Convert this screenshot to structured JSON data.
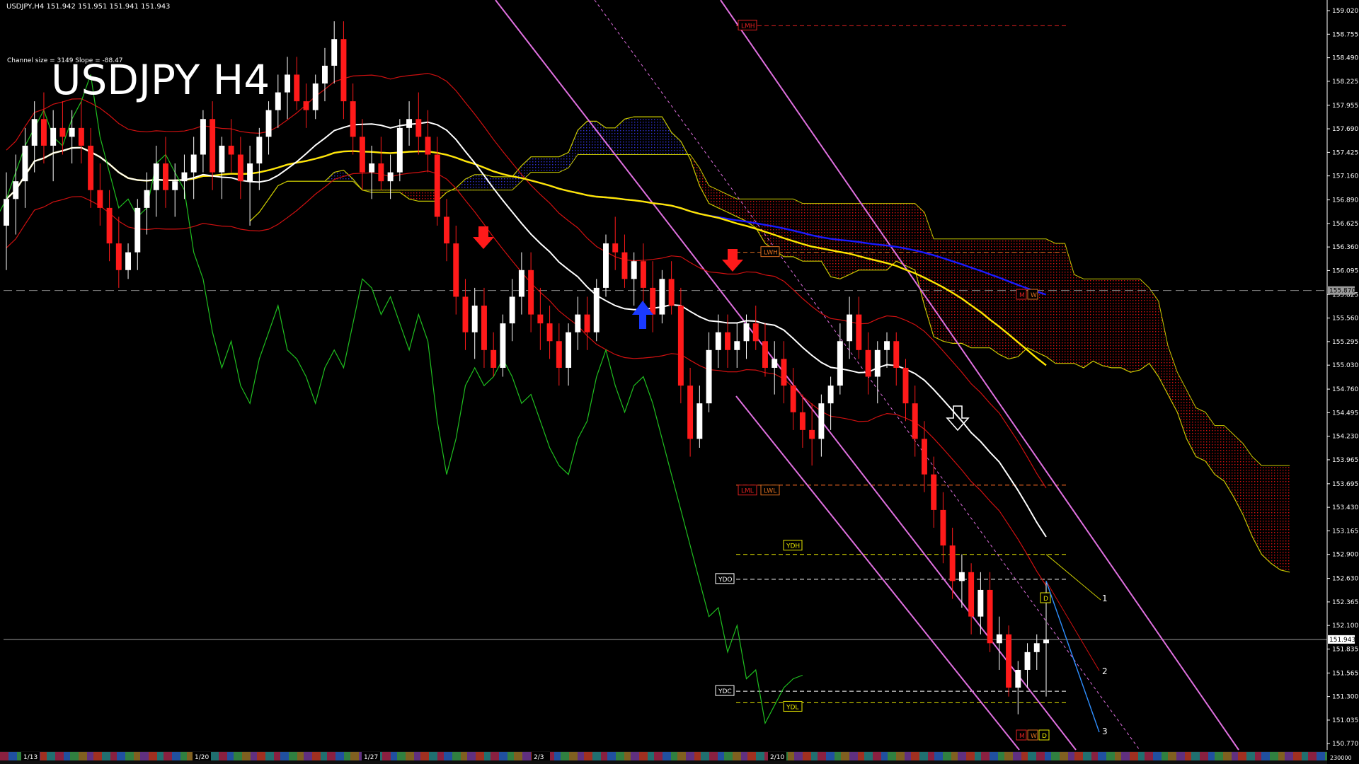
{
  "window": {
    "header": "USDJPY,H4  151.942 151.951 151.941 151.943",
    "channel_info": "Channel size = 3149 Slope = -88.47",
    "overlay_title": "USDJPY H4"
  },
  "colors": {
    "background": "#000000",
    "bull_candle": "#ffffff",
    "bear_candle": "#ff1a1a",
    "ma_white": "#ffffff",
    "ma_yellow": "#ffe600",
    "ma_blue": "#1a1aff",
    "chikou_green": "#1fbf1f",
    "envelope_red": "#d01010",
    "envelope_yellow": "#c8c800",
    "channel_violet": "#e070e0",
    "cloud_blue": "#2020c0",
    "cloud_red": "#c01010",
    "forecast_blue": "#2f8fff"
  },
  "chart_data": {
    "type": "candlestick",
    "symbol": "USDJPY",
    "timeframe": "H4",
    "last_price": 151.943,
    "current_price_label": "151.943",
    "reference_price_label": "155.870",
    "ylim": [
      150.7,
      159.1
    ],
    "y_tick_labels": [
      "159.020",
      "158.755",
      "158.490",
      "158.225",
      "157.955",
      "157.690",
      "157.425",
      "157.160",
      "156.890",
      "156.625",
      "156.360",
      "156.095",
      "155.825",
      "155.560",
      "155.295",
      "155.030",
      "154.760",
      "154.495",
      "154.230",
      "153.965",
      "153.695",
      "153.430",
      "153.165",
      "152.900",
      "152.630",
      "152.365",
      "152.100",
      "151.835",
      "151.565",
      "151.300",
      "151.035",
      "150.770"
    ],
    "x_tick_labels": [
      "1/13",
      "1/20",
      "1/27",
      "2/3",
      "2/10"
    ],
    "volume_scale_label": "230000",
    "candles": [
      {
        "o": 156.6,
        "h": 157.2,
        "l": 156.1,
        "c": 156.9
      },
      {
        "o": 156.9,
        "h": 157.4,
        "l": 156.5,
        "c": 157.1
      },
      {
        "o": 157.1,
        "h": 157.7,
        "l": 156.8,
        "c": 157.5
      },
      {
        "o": 157.5,
        "h": 158.0,
        "l": 157.2,
        "c": 157.8
      },
      {
        "o": 157.8,
        "h": 158.1,
        "l": 157.3,
        "c": 157.5
      },
      {
        "o": 157.5,
        "h": 157.9,
        "l": 157.1,
        "c": 157.7
      },
      {
        "o": 157.7,
        "h": 158.0,
        "l": 157.4,
        "c": 157.6
      },
      {
        "o": 157.6,
        "h": 157.9,
        "l": 157.3,
        "c": 157.7
      },
      {
        "o": 157.7,
        "h": 158.0,
        "l": 157.3,
        "c": 157.5
      },
      {
        "o": 157.5,
        "h": 157.7,
        "l": 156.8,
        "c": 157.0
      },
      {
        "o": 157.0,
        "h": 157.3,
        "l": 156.6,
        "c": 156.8
      },
      {
        "o": 156.8,
        "h": 157.0,
        "l": 156.2,
        "c": 156.4
      },
      {
        "o": 156.4,
        "h": 156.7,
        "l": 155.9,
        "c": 156.1
      },
      {
        "o": 156.1,
        "h": 156.4,
        "l": 156.0,
        "c": 156.3
      },
      {
        "o": 156.3,
        "h": 156.9,
        "l": 156.1,
        "c": 156.8
      },
      {
        "o": 156.8,
        "h": 157.2,
        "l": 156.5,
        "c": 157.0
      },
      {
        "o": 157.0,
        "h": 157.5,
        "l": 156.7,
        "c": 157.3
      },
      {
        "o": 157.3,
        "h": 157.6,
        "l": 156.8,
        "c": 157.0
      },
      {
        "o": 157.0,
        "h": 157.3,
        "l": 156.7,
        "c": 157.1
      },
      {
        "o": 157.1,
        "h": 157.4,
        "l": 156.9,
        "c": 157.2
      },
      {
        "o": 157.2,
        "h": 157.6,
        "l": 156.9,
        "c": 157.4
      },
      {
        "o": 157.4,
        "h": 157.9,
        "l": 157.2,
        "c": 157.8
      },
      {
        "o": 157.8,
        "h": 158.0,
        "l": 157.0,
        "c": 157.2
      },
      {
        "o": 157.2,
        "h": 157.6,
        "l": 156.9,
        "c": 157.5
      },
      {
        "o": 157.5,
        "h": 157.8,
        "l": 157.2,
        "c": 157.4
      },
      {
        "o": 157.4,
        "h": 157.6,
        "l": 156.9,
        "c": 157.1
      },
      {
        "o": 157.1,
        "h": 157.5,
        "l": 156.6,
        "c": 157.3
      },
      {
        "o": 157.3,
        "h": 157.7,
        "l": 157.0,
        "c": 157.6
      },
      {
        "o": 157.6,
        "h": 158.0,
        "l": 157.4,
        "c": 157.9
      },
      {
        "o": 157.9,
        "h": 158.3,
        "l": 157.7,
        "c": 158.1
      },
      {
        "o": 158.1,
        "h": 158.5,
        "l": 157.8,
        "c": 158.3
      },
      {
        "o": 158.3,
        "h": 158.5,
        "l": 157.9,
        "c": 158.0
      },
      {
        "o": 158.0,
        "h": 158.2,
        "l": 157.7,
        "c": 157.9
      },
      {
        "o": 157.9,
        "h": 158.3,
        "l": 157.8,
        "c": 158.2
      },
      {
        "o": 158.2,
        "h": 158.6,
        "l": 158.0,
        "c": 158.4
      },
      {
        "o": 158.4,
        "h": 158.9,
        "l": 158.2,
        "c": 158.7
      },
      {
        "o": 158.7,
        "h": 158.9,
        "l": 157.8,
        "c": 158.0
      },
      {
        "o": 158.0,
        "h": 158.2,
        "l": 157.4,
        "c": 157.6
      },
      {
        "o": 157.6,
        "h": 157.8,
        "l": 157.0,
        "c": 157.2
      },
      {
        "o": 157.2,
        "h": 157.5,
        "l": 156.9,
        "c": 157.3
      },
      {
        "o": 157.3,
        "h": 157.6,
        "l": 157.0,
        "c": 157.1
      },
      {
        "o": 157.1,
        "h": 157.4,
        "l": 156.9,
        "c": 157.2
      },
      {
        "o": 157.2,
        "h": 157.8,
        "l": 157.1,
        "c": 157.7
      },
      {
        "o": 157.7,
        "h": 158.0,
        "l": 157.5,
        "c": 157.8
      },
      {
        "o": 157.8,
        "h": 158.1,
        "l": 157.4,
        "c": 157.6
      },
      {
        "o": 157.6,
        "h": 157.9,
        "l": 157.2,
        "c": 157.4
      },
      {
        "o": 157.4,
        "h": 157.6,
        "l": 156.6,
        "c": 156.7
      },
      {
        "o": 156.7,
        "h": 156.9,
        "l": 156.2,
        "c": 156.4
      },
      {
        "o": 156.4,
        "h": 156.6,
        "l": 155.6,
        "c": 155.8
      },
      {
        "o": 155.8,
        "h": 156.0,
        "l": 155.2,
        "c": 155.4
      },
      {
        "o": 155.4,
        "h": 155.9,
        "l": 155.1,
        "c": 155.7
      },
      {
        "o": 155.7,
        "h": 155.9,
        "l": 155.0,
        "c": 155.2
      },
      {
        "o": 155.2,
        "h": 155.4,
        "l": 154.9,
        "c": 155.0
      },
      {
        "o": 155.0,
        "h": 155.6,
        "l": 154.9,
        "c": 155.5
      },
      {
        "o": 155.5,
        "h": 156.0,
        "l": 155.3,
        "c": 155.8
      },
      {
        "o": 155.8,
        "h": 156.3,
        "l": 155.6,
        "c": 156.1
      },
      {
        "o": 156.1,
        "h": 156.3,
        "l": 155.4,
        "c": 155.6
      },
      {
        "o": 155.6,
        "h": 155.9,
        "l": 155.2,
        "c": 155.5
      },
      {
        "o": 155.5,
        "h": 155.7,
        "l": 155.1,
        "c": 155.3
      },
      {
        "o": 155.3,
        "h": 155.5,
        "l": 154.8,
        "c": 155.0
      },
      {
        "o": 155.0,
        "h": 155.5,
        "l": 154.8,
        "c": 155.4
      },
      {
        "o": 155.4,
        "h": 155.8,
        "l": 155.2,
        "c": 155.6
      },
      {
        "o": 155.6,
        "h": 155.8,
        "l": 155.2,
        "c": 155.4
      },
      {
        "o": 155.4,
        "h": 156.0,
        "l": 155.3,
        "c": 155.9
      },
      {
        "o": 155.9,
        "h": 156.5,
        "l": 155.8,
        "c": 156.4
      },
      {
        "o": 156.4,
        "h": 156.7,
        "l": 156.1,
        "c": 156.3
      },
      {
        "o": 156.3,
        "h": 156.5,
        "l": 155.9,
        "c": 156.0
      },
      {
        "o": 156.0,
        "h": 156.3,
        "l": 155.7,
        "c": 156.2
      },
      {
        "o": 156.2,
        "h": 156.4,
        "l": 155.7,
        "c": 155.9
      },
      {
        "o": 155.9,
        "h": 156.2,
        "l": 155.4,
        "c": 155.6
      },
      {
        "o": 155.6,
        "h": 156.1,
        "l": 155.5,
        "c": 156.0
      },
      {
        "o": 156.0,
        "h": 156.2,
        "l": 155.6,
        "c": 155.7
      },
      {
        "o": 155.7,
        "h": 155.9,
        "l": 154.6,
        "c": 154.8
      },
      {
        "o": 154.8,
        "h": 155.0,
        "l": 154.0,
        "c": 154.2
      },
      {
        "o": 154.2,
        "h": 154.8,
        "l": 154.1,
        "c": 154.6
      },
      {
        "o": 154.6,
        "h": 155.4,
        "l": 154.5,
        "c": 155.2
      },
      {
        "o": 155.2,
        "h": 155.6,
        "l": 155.0,
        "c": 155.4
      },
      {
        "o": 155.4,
        "h": 155.6,
        "l": 155.0,
        "c": 155.2
      },
      {
        "o": 155.2,
        "h": 155.5,
        "l": 155.0,
        "c": 155.3
      },
      {
        "o": 155.3,
        "h": 155.6,
        "l": 155.1,
        "c": 155.5
      },
      {
        "o": 155.5,
        "h": 155.7,
        "l": 155.2,
        "c": 155.3
      },
      {
        "o": 155.3,
        "h": 155.5,
        "l": 154.9,
        "c": 155.0
      },
      {
        "o": 155.0,
        "h": 155.3,
        "l": 154.7,
        "c": 155.1
      },
      {
        "o": 155.1,
        "h": 155.3,
        "l": 154.6,
        "c": 154.8
      },
      {
        "o": 154.8,
        "h": 155.0,
        "l": 154.3,
        "c": 154.5
      },
      {
        "o": 154.5,
        "h": 154.7,
        "l": 154.1,
        "c": 154.3
      },
      {
        "o": 154.3,
        "h": 154.6,
        "l": 153.9,
        "c": 154.2
      },
      {
        "o": 154.2,
        "h": 154.7,
        "l": 154.0,
        "c": 154.6
      },
      {
        "o": 154.6,
        "h": 154.9,
        "l": 154.3,
        "c": 154.8
      },
      {
        "o": 154.8,
        "h": 155.5,
        "l": 154.7,
        "c": 155.3
      },
      {
        "o": 155.3,
        "h": 155.8,
        "l": 155.1,
        "c": 155.6
      },
      {
        "o": 155.6,
        "h": 155.8,
        "l": 155.1,
        "c": 155.2
      },
      {
        "o": 155.2,
        "h": 155.4,
        "l": 154.7,
        "c": 154.9
      },
      {
        "o": 154.9,
        "h": 155.3,
        "l": 154.6,
        "c": 155.2
      },
      {
        "o": 155.2,
        "h": 155.4,
        "l": 155.0,
        "c": 155.3
      },
      {
        "o": 155.3,
        "h": 155.4,
        "l": 154.8,
        "c": 155.0
      },
      {
        "o": 155.0,
        "h": 155.1,
        "l": 154.4,
        "c": 154.6
      },
      {
        "o": 154.6,
        "h": 154.8,
        "l": 154.0,
        "c": 154.2
      },
      {
        "o": 154.2,
        "h": 154.4,
        "l": 153.6,
        "c": 153.8
      },
      {
        "o": 153.8,
        "h": 154.0,
        "l": 153.2,
        "c": 153.4
      },
      {
        "o": 153.4,
        "h": 153.6,
        "l": 152.8,
        "c": 153.0
      },
      {
        "o": 153.0,
        "h": 153.2,
        "l": 152.4,
        "c": 152.6
      },
      {
        "o": 152.6,
        "h": 152.9,
        "l": 152.3,
        "c": 152.7
      },
      {
        "o": 152.7,
        "h": 152.8,
        "l": 152.0,
        "c": 152.2
      },
      {
        "o": 152.2,
        "h": 152.7,
        "l": 152.0,
        "c": 152.5
      },
      {
        "o": 152.5,
        "h": 152.7,
        "l": 151.8,
        "c": 151.9
      },
      {
        "o": 151.9,
        "h": 152.2,
        "l": 151.6,
        "c": 152.0
      },
      {
        "o": 152.0,
        "h": 152.1,
        "l": 151.3,
        "c": 151.4
      },
      {
        "o": 151.4,
        "h": 151.7,
        "l": 151.1,
        "c": 151.6
      },
      {
        "o": 151.6,
        "h": 151.9,
        "l": 151.4,
        "c": 151.8
      },
      {
        "o": 151.8,
        "h": 152.0,
        "l": 151.6,
        "c": 151.9
      },
      {
        "o": 151.9,
        "h": 152.6,
        "l": 151.3,
        "c": 151.94
      }
    ],
    "horizontal_levels": [
      {
        "label": "LMH",
        "value": 158.85,
        "color": "#e02020"
      },
      {
        "label": "LWH",
        "value": 156.3,
        "color": "#e07020"
      },
      {
        "label": "LML",
        "value": 153.68,
        "color": "#e02020"
      },
      {
        "label": "LWL",
        "value": 153.68,
        "color": "#e07020"
      },
      {
        "label": "YDH",
        "value": 152.9,
        "color": "#e8e800"
      },
      {
        "label": "YDO",
        "value": 152.62,
        "color": "#ffffff"
      },
      {
        "label": "YDC",
        "value": 151.36,
        "color": "#ffffff"
      },
      {
        "label": "YDL",
        "value": 151.23,
        "color": "#e8e800"
      }
    ],
    "marker_labels": [
      "M",
      "W",
      "D"
    ],
    "projection_labels": [
      "1",
      "2",
      "3"
    ]
  }
}
